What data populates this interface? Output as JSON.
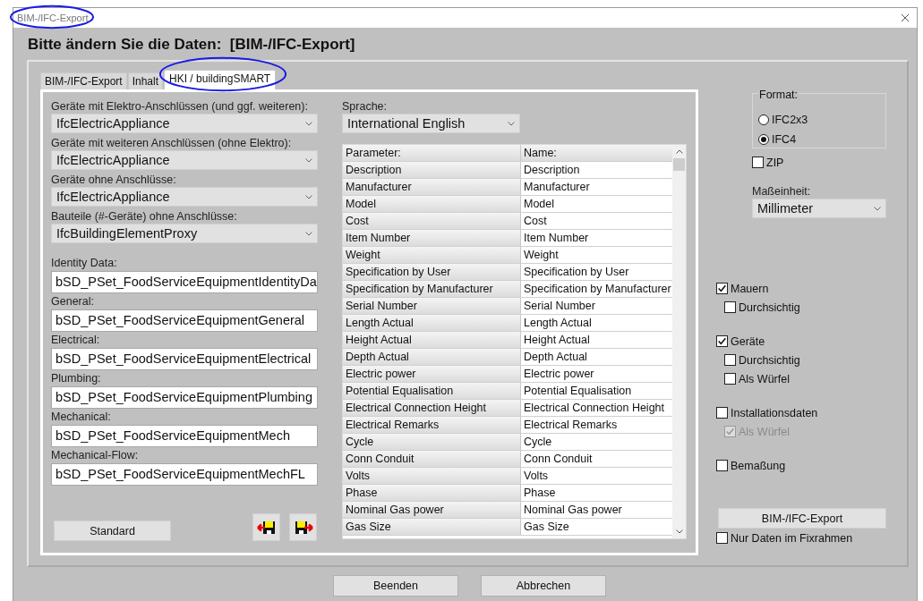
{
  "window": {
    "title": "BIM-/IFC-Export",
    "heading": "Bitte ändern Sie die Daten:  [BIM-/IFC-Export]"
  },
  "annotations": [
    {
      "kind": "circle"
    },
    {
      "kind": "circle"
    }
  ],
  "tabs": [
    {
      "label": "BIM-/IFC-Export",
      "selected": false
    },
    {
      "label": "Inhalt",
      "selected": false
    },
    {
      "label": "HKI / buildingSMART",
      "selected": true
    }
  ],
  "dropdowns": [
    {
      "label": "Geräte mit Elektro-Anschlüssen (und ggf. weiteren):",
      "value": "IfcElectricAppliance"
    },
    {
      "label": "Geräte mit weiteren Anschlüssen (ohne Elektro):",
      "value": "IfcElectricAppliance"
    },
    {
      "label": "Geräte ohne Anschlüsse:",
      "value": "IfcElectricAppliance"
    },
    {
      "label": "Bauteile (#-Geräte) ohne Anschlüsse:",
      "value": "IfcBuildingElementProxy"
    }
  ],
  "psets": [
    {
      "label": "Identity Data:",
      "value": "bSD_PSet_FoodServiceEquipmentIdentityDa"
    },
    {
      "label": "General:",
      "value": "bSD_PSet_FoodServiceEquipmentGeneral"
    },
    {
      "label": "Electrical:",
      "value": "bSD_PSet_FoodServiceEquipmentElectrical"
    },
    {
      "label": "Plumbing:",
      "value": "bSD_PSet_FoodServiceEquipmentPlumbing"
    },
    {
      "label": "Mechanical:",
      "value": "bSD_PSet_FoodServiceEquipmentMech"
    },
    {
      "label": "Mechanical-Flow:",
      "value": "bSD_PSet_FoodServiceEquipmentMechFL"
    }
  ],
  "standard_button": "Standard",
  "language": {
    "label": "Sprache:",
    "value": "International English"
  },
  "table": {
    "columns": [
      "Parameter:",
      "Name:"
    ],
    "rows": [
      [
        "Description",
        "Description"
      ],
      [
        "Manufacturer",
        "Manufacturer"
      ],
      [
        "Model",
        "Model"
      ],
      [
        "Cost",
        "Cost"
      ],
      [
        "Item Number",
        "Item Number"
      ],
      [
        "Weight",
        "Weight"
      ],
      [
        "Specification by User",
        "Specification by User"
      ],
      [
        "Specification by Manufacturer",
        "Specification by Manufacturer"
      ],
      [
        "Serial Number",
        "Serial Number"
      ],
      [
        "Length Actual",
        "Length Actual"
      ],
      [
        "Height Actual",
        "Height Actual"
      ],
      [
        "Depth Actual",
        "Depth Actual"
      ],
      [
        "Electric power",
        "Electric power"
      ],
      [
        "Potential Equalisation",
        "Potential Equalisation"
      ],
      [
        "Electrical Connection Height",
        "Electrical Connection Height"
      ],
      [
        "Electrical Remarks",
        "Electrical Remarks"
      ],
      [
        "Cycle",
        "Cycle"
      ],
      [
        "Conn Conduit",
        "Conn Conduit"
      ],
      [
        "Volts",
        "Volts"
      ],
      [
        "Phase",
        "Phase"
      ],
      [
        "Nominal Gas power",
        "Nominal Gas power"
      ],
      [
        "Gas Size",
        "Gas Size"
      ]
    ]
  },
  "format": {
    "label": "Format:",
    "options": [
      {
        "label": "IFC2x3",
        "selected": false
      },
      {
        "label": "IFC4",
        "selected": true
      }
    ]
  },
  "zip": {
    "label": "ZIP",
    "checked": false
  },
  "unit": {
    "label": "Maßeinheit:",
    "value": "Millimeter"
  },
  "options": [
    {
      "label": "Mauern",
      "checked": true,
      "disabled": false,
      "children": [
        {
          "label": "Durchsichtig",
          "checked": false,
          "disabled": false
        }
      ]
    },
    {
      "label": "Geräte",
      "checked": true,
      "disabled": false,
      "children": [
        {
          "label": "Durchsichtig",
          "checked": false,
          "disabled": false
        },
        {
          "label": "Als Würfel",
          "checked": false,
          "disabled": false
        }
      ]
    },
    {
      "label": "Installationsdaten",
      "checked": false,
      "disabled": false,
      "children": [
        {
          "label": "Als Würfel",
          "checked": true,
          "disabled": true
        }
      ]
    },
    {
      "label": "Bemaßung",
      "checked": false,
      "disabled": false
    }
  ],
  "export_button": "BIM-/IFC-Export",
  "fixrahmen": {
    "label": "Nur Daten im Fixrahmen",
    "checked": false
  },
  "buttons": [
    "Beenden",
    "Abbrechen"
  ]
}
